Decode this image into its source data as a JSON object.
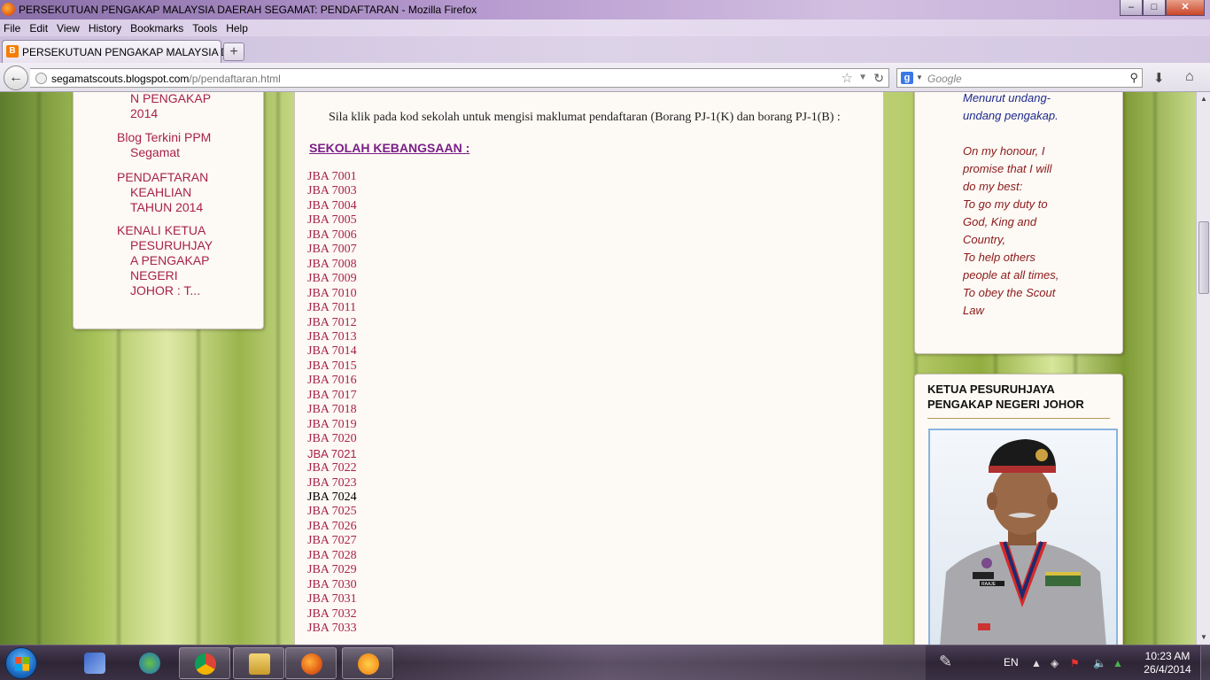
{
  "window": {
    "title": "PERSEKUTUAN PENGAKAP MALAYSIA DAERAH SEGAMAT: PENDAFTARAN - Mozilla Firefox",
    "minimize": "–",
    "maximize": "□",
    "close": "✕"
  },
  "menu": {
    "file": "File",
    "edit": "Edit",
    "view": "View",
    "history": "History",
    "bookmarks": "Bookmarks",
    "tools": "Tools",
    "help": "Help"
  },
  "tab": {
    "title": "PERSEKUTUAN PENGAKAP MALAYSIA D...",
    "favicon": "B",
    "new_tab": "+"
  },
  "nav": {
    "url_host": "segamatscouts.blogspot.com",
    "url_path": "/p/pendaftaran.html",
    "search_placeholder": "Google"
  },
  "sidebar_left": {
    "items": [
      {
        "first": "",
        "rest": "N PENGAKAP"
      },
      {
        "first": "",
        "rest": "2014"
      },
      {
        "first": "Blog Terkini PPM",
        "rest": "Segamat"
      },
      {
        "first": "PENDAFTARAN",
        "rest": "KEAHLIAN"
      },
      {
        "first": "",
        "rest": "TAHUN 2014"
      },
      {
        "first": "KENALI KETUA",
        "rest": "PESURUHJAY"
      },
      {
        "first": "",
        "rest": "A PENGAKAP"
      },
      {
        "first": "",
        "rest": "NEGERI"
      },
      {
        "first": "",
        "rest": "JOHOR : T..."
      }
    ]
  },
  "main": {
    "intro": "Sila klik pada kod sekolah untuk mengisi maklumat pendaftaran (Borang PJ-1(K) dan borang PJ-1(B) :",
    "heading": "SEKOLAH KEBANGSAAN :",
    "codes": [
      "JBA 7001",
      "JBA 7003",
      "JBA 7004",
      "JBA 7005",
      "JBA 7006",
      "JBA 7007",
      "JBA 7008",
      "JBA 7009",
      "JBA 7010",
      "JBA 7011",
      "JBA 7012",
      "JBA 7013",
      "JBA 7014",
      "JBA 7015",
      "JBA 7016",
      "JBA 7017",
      "JBA 7018",
      "JBA 7019",
      "JBA 7020",
      "JBA 7021",
      "JBA 7022",
      "JBA 7023",
      "JBA 7024",
      "JBA 7025",
      "JBA 7026",
      "JBA 7027",
      "JBA 7028",
      "JBA 7029",
      "JBA 7030",
      "JBA 7031",
      "JBA 7032",
      "JBA 7033"
    ]
  },
  "sidebar_right": {
    "malay_lines": [
      "Menurut undang-",
      "undang pengakap."
    ],
    "english_lines": [
      "On my honour, I",
      "promise that I will",
      "do my best:",
      "To go my duty to",
      "God, King and",
      "Country,",
      "To help others",
      "people at all times,",
      "To obey the Scout",
      "Law"
    ],
    "widget_title": "KETUA PESURUHJAYA PENGAKAP NEGERI JOHOR",
    "nametag": "RAAJE"
  },
  "taskbar": {
    "language": "EN",
    "time": "10:23 AM",
    "date": "26/4/2014"
  }
}
